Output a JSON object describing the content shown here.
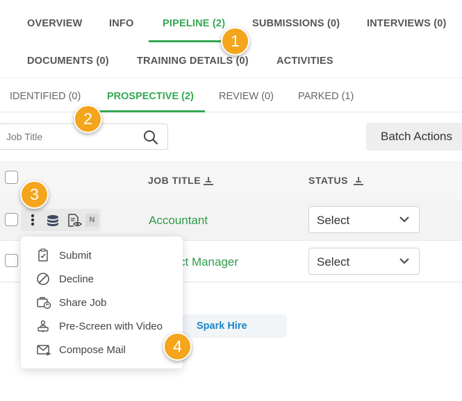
{
  "main_tabs": [
    {
      "label": "OVERVIEW",
      "active": false
    },
    {
      "label": "INFO",
      "active": false
    },
    {
      "label": "PIPELINE (2)",
      "active": true
    },
    {
      "label": "SUBMISSIONS (0)",
      "active": false
    },
    {
      "label": "INTERVIEWS (0)",
      "active": false
    },
    {
      "label": "DOCUMENTS (0)",
      "active": false
    },
    {
      "label": "TRAINING DETAILS (0)",
      "active": false
    },
    {
      "label": "ACTIVITIES",
      "active": false
    }
  ],
  "sub_tabs": [
    {
      "label": "IDENTIFIED (0)",
      "active": false
    },
    {
      "label": "PROSPECTIVE (2)",
      "active": true
    },
    {
      "label": "REVIEW (0)",
      "active": false
    },
    {
      "label": "PARKED (1)",
      "active": false
    }
  ],
  "search": {
    "placeholder": "Job Title",
    "value": ""
  },
  "batch_actions_label": "Batch Actions",
  "table": {
    "columns": [
      "JOB TITLE",
      "STATUS"
    ],
    "rows": [
      {
        "job_title": "Accountant",
        "status": "Select",
        "badge": "N"
      },
      {
        "job_title": "ct Manager",
        "status": "Select"
      }
    ]
  },
  "context_menu": {
    "items": [
      {
        "label": "Submit",
        "icon": "submit-icon"
      },
      {
        "label": "Decline",
        "icon": "decline-icon"
      },
      {
        "label": "Share Job",
        "icon": "share-job-icon"
      },
      {
        "label": "Pre-Screen with Video",
        "icon": "video-prescreen-icon"
      },
      {
        "label": "Compose Mail",
        "icon": "compose-mail-icon"
      }
    ]
  },
  "spark_hire_label": "Spark Hire",
  "markers": [
    "1",
    "2",
    "3",
    "4"
  ],
  "colors": {
    "accent_green": "#34a853",
    "link_blue": "#1c86c8",
    "marker_orange": "#f4a51c"
  }
}
